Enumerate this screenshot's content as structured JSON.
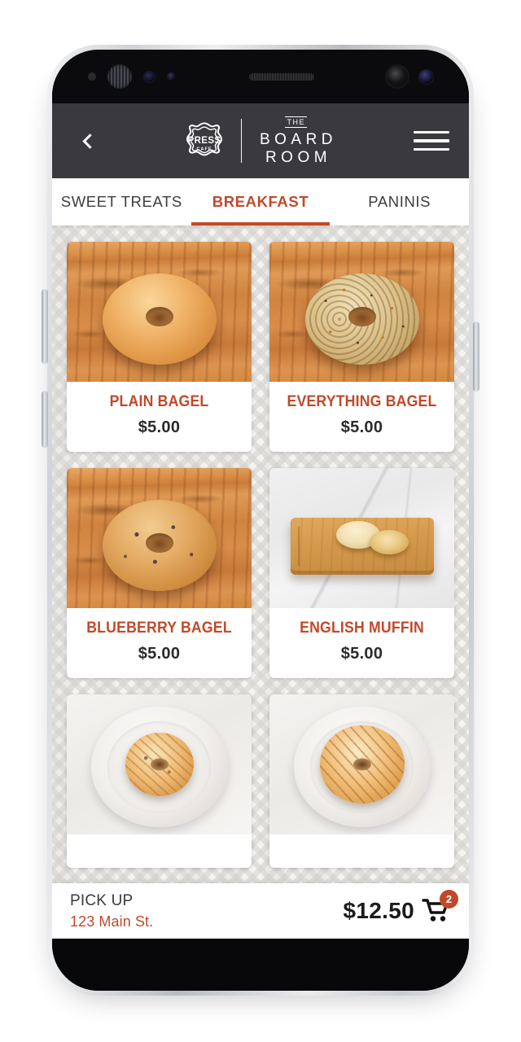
{
  "header": {
    "back_icon": "chevron-left-icon",
    "menu_icon": "hamburger-menu-icon",
    "logo_badge_line1": "PRESS",
    "logo_badge_line2": "CAFE",
    "brand_the": "THE",
    "brand_board": "BOARD",
    "brand_room": "ROOM",
    "background_color": "#3A3A3E"
  },
  "tabs": {
    "items": [
      {
        "label": "SWEET TREATS",
        "active": false
      },
      {
        "label": "BREAKFAST",
        "active": true
      },
      {
        "label": "PANINIS",
        "active": false
      }
    ],
    "accent_color": "#BF4A2B"
  },
  "menu": {
    "items": [
      {
        "name": "PLAIN BAGEL",
        "price": "$5.00",
        "image": "plain-bagel-on-wooden-board"
      },
      {
        "name": "EVERYTHING BAGEL",
        "price": "$5.00",
        "image": "everything-bagel-on-wooden-board"
      },
      {
        "name": "BLUEBERRY BAGEL",
        "price": "$5.00",
        "image": "blueberry-bagel-on-wooden-board"
      },
      {
        "name": "ENGLISH MUFFIN",
        "price": "$5.00",
        "image": "english-muffin-on-wooden-board"
      },
      {
        "name": "",
        "price": "",
        "image": "small-bagel-on-white-plate"
      },
      {
        "name": "",
        "price": "",
        "image": "large-bagel-on-white-plate"
      }
    ]
  },
  "bottom_bar": {
    "order_type": "PICK UP",
    "address": "123 Main St.",
    "total": "$12.50",
    "cart_icon": "shopping-cart-icon",
    "cart_count": "2",
    "badge_color": "#BF4A2B",
    "address_color": "#BF4A2B"
  }
}
